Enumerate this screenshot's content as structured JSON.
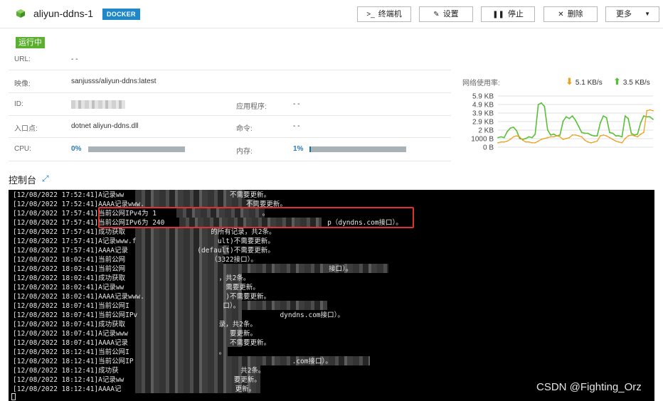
{
  "header": {
    "title": "aliyun-ddns-1",
    "badge": "DOCKER",
    "buttons": {
      "terminal": "终端机",
      "settings": "设置",
      "stop": "停止",
      "delete": "删除",
      "more": "更多"
    }
  },
  "status": "运行中",
  "info": {
    "url_label": "URL:",
    "url_value": "- -",
    "image_label": "映像:",
    "image_value": "sanjusss/aliyun-ddns:latest",
    "id_label": "ID:",
    "app_label": "应用程序:",
    "app_value": "- -",
    "entry_label": "入口点:",
    "entry_value": "dotnet aliyun-ddns.dll",
    "cmd_label": "命令:",
    "cmd_value": "- -",
    "cpu_label": "CPU:",
    "cpu_value": "0%",
    "cpu_fraction": 0.0,
    "mem_label": "内存:",
    "mem_value": "1%",
    "mem_fraction": 0.01
  },
  "network": {
    "label": "网络使用率:",
    "down": "5.1 KB/s",
    "up": "3.5 KB/s",
    "colors": {
      "down": "#f0a020",
      "up": "#58c038"
    }
  },
  "chart_data": {
    "type": "line",
    "title": "",
    "xlabel": "",
    "ylabel": "",
    "y_ticks": [
      "5.9 KB",
      "4.9 KB",
      "3.9 KB",
      "2.9 KB",
      "2 KB",
      "1000 B",
      "0 B"
    ],
    "ylim": [
      0,
      5900
    ],
    "grid": true,
    "series": [
      {
        "color": "#58c038",
        "values": [
          1100,
          1200,
          1100,
          1800,
          2200,
          2300,
          1900,
          1000,
          900,
          1000,
          1200,
          1100,
          1500,
          4900,
          5100,
          4700,
          2000,
          1400,
          1500,
          1300,
          1400,
          3000,
          3500,
          3300,
          3600,
          3100,
          2400,
          1700,
          1600,
          1600,
          1400,
          1300,
          1300,
          2800,
          3600,
          3400,
          1700,
          1600,
          1300,
          1300,
          1200,
          3600,
          3300,
          1600,
          1400,
          1500,
          2800,
          3600,
          3500,
          3500,
          3200
        ]
      },
      {
        "color": "#f0a020",
        "values": [
          500,
          600,
          600,
          700,
          900,
          1200,
          1300,
          1200,
          800,
          600,
          600,
          500,
          500,
          700,
          900,
          1000,
          1100,
          1200,
          1200,
          1300,
          1200,
          900,
          1000,
          1100,
          1400,
          1400,
          1300,
          1200,
          800,
          600,
          500,
          600,
          700,
          1300,
          1400,
          1300,
          1100,
          900,
          700,
          600,
          500,
          1000,
          1300,
          1400,
          1300,
          1200,
          1500,
          1700,
          4200,
          4300,
          4200
        ]
      }
    ]
  },
  "console": {
    "title": "控制台",
    "lines": [
      "[12/08/2022 17:52:41]A记录ww                          不需要更新。",
      "[12/08/2022 17:52:41]AAAA记录www.                         不需要更新。",
      "[12/08/2022 17:57:41]当前公网IPv4为 1                          。",
      "[12/08/2022 17:57:41]当前公网IPv6为 240                                        p（dyndns.com接口）。",
      "[12/08/2022 17:57:41]成功获取                     的所有记录，共2条。",
      "[12/08/2022 17:57:41]A记录www.f                    ult)不需要更新。",
      "[12/08/2022 17:57:41]AAAA记录                 (default)不需要更新。",
      "[12/08/2022 18:02:41]当前公网                     （3322接口）。",
      "[12/08/2022 18:02:41]当前公网                                                  接口）。",
      "[12/08/2022 18:02:41]成功获取                       ，共2条。",
      "[12/08/2022 18:02:41]A记录ww                         需要更新。",
      "[12/08/2022 18:02:41]AAAA记录www.                    )不需要更新。",
      "[12/08/2022 18:07:41]当前公网I                       口）。",
      "[12/08/2022 18:07:41]当前公网IPv                                   dyndns.com接口）。",
      "[12/08/2022 18:07:41]成功获取                       录，共2条。",
      "[12/08/2022 18:07:41]A记录www                         要更新。",
      "[12/08/2022 18:07:41]AAAA记录                         不需要更新。",
      "[12/08/2022 18:12:41]当前公网I                      。",
      "[12/08/2022 18:12:41]当前公网IP                                       .com接口）。",
      "[12/08/2022 18:12:41]成功获                              共2条。",
      "[12/08/2022 18:12:41]A记录ww                           要更新。",
      "[12/08/2022 18:12:41]AAAA记                            更新。"
    ]
  },
  "watermark": "CSDN @Fighting_Orz"
}
